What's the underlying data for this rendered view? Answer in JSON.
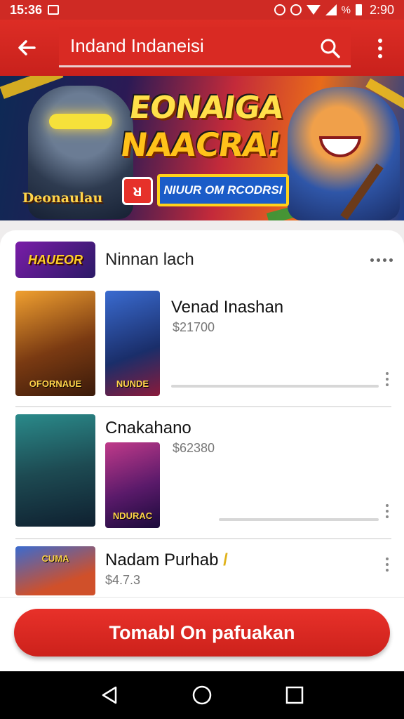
{
  "status_bar": {
    "time_left": "15:36",
    "battery_text": "%",
    "time_right": "2:90"
  },
  "app_bar": {
    "title": "Indand Indaneisi"
  },
  "banner": {
    "headline_line1": "EONAIGA",
    "headline_line2": "NAACRA!",
    "tag_left": "Deonaulau",
    "cta_label": "NIUUR OM RCODRSI",
    "badge": "ᴚ"
  },
  "section": {
    "thumb_label": "HAUEOR",
    "title": "Ninnan lach"
  },
  "items": [
    {
      "title": "Venad Inashan",
      "price": "$21700",
      "art_big": "OFORNAUE",
      "art_small": "NUNDE"
    },
    {
      "title": "Cnakahano",
      "price": "$62380",
      "art_big": "",
      "art_small": "NDURAC"
    },
    {
      "title": "Nadam Purhab",
      "price": "$4.7.3",
      "art_big": "CUMA"
    }
  ],
  "bottom_cta": {
    "label": "Tomabl On pafuakan"
  },
  "colors": {
    "primary_red": "#d92a23",
    "banner_gold": "#ffc21a"
  },
  "icons": [
    "back-arrow-icon",
    "search-icon",
    "more-vert-icon",
    "nav-back-icon",
    "nav-home-icon",
    "nav-recents-icon"
  ]
}
